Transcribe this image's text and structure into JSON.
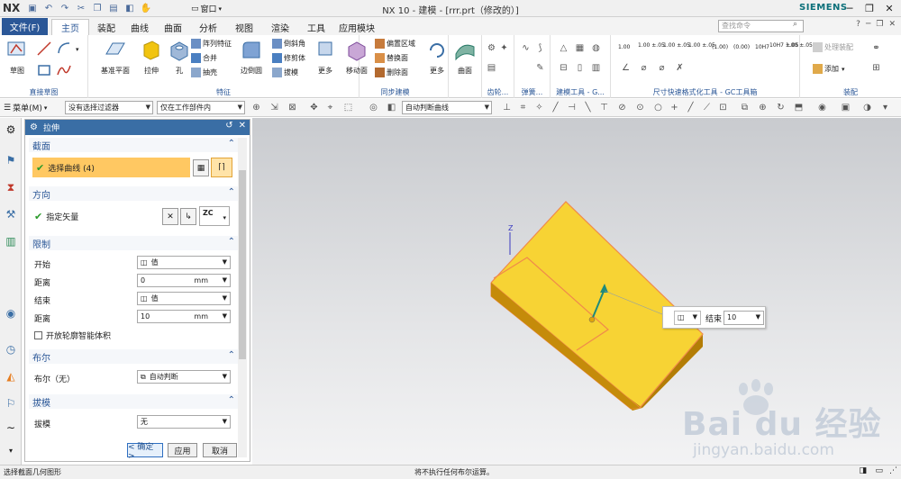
{
  "app": {
    "logo": "NX",
    "title": "NX 10 - 建模 - [rrr.prt（修改的）]",
    "brand": "SIEMENS",
    "window_menu": "窗口"
  },
  "tabs": {
    "file": "文件(F)",
    "items": [
      "主页",
      "装配",
      "曲线",
      "曲面",
      "分析",
      "视图",
      "渲染",
      "工具",
      "应用模块"
    ],
    "active": "主页",
    "search_placeholder": "查找命令"
  },
  "ribbon": {
    "sketch": {
      "big": "草图",
      "group": "直接草图"
    },
    "feature": {
      "datum": "基准平面",
      "extrude": "拉伸",
      "hole": "孔",
      "small": [
        "阵列特征",
        "合并",
        "抽壳"
      ],
      "edge": "边倒圆",
      "small2": [
        "倒斜角",
        "修剪体",
        "拔模"
      ],
      "more": "更多",
      "group": "特征"
    },
    "sync": {
      "move": "移动面",
      "small": [
        "偏置区域",
        "替换面",
        "删除面"
      ],
      "more": "更多",
      "group": "同步建模"
    },
    "surface": {
      "big": "曲面"
    },
    "small_groups": {
      "gear": "齿轮...",
      "spring": "弹簧...",
      "tools": "建模工具 - G..."
    },
    "dim": {
      "group": "尺寸快速格式化工具 - GC工具箱",
      "labels": [
        "1.00",
        "1.00 ±.05",
        "1.00 ±.05",
        "1.00 ±.05",
        "(1.00)",
        "(0.00)",
        "10H7",
        "10H7 ±.05",
        "1.00 ±.05"
      ]
    },
    "assembly": {
      "process": "处理装配",
      "add": "添加",
      "group": "装配"
    }
  },
  "toolbar2": {
    "menu": "菜单(M)",
    "filter": "没有选择过滤器",
    "scope": "仅在工作部件内",
    "curve_rule": "自动判断曲线"
  },
  "dialog": {
    "title": "拉伸",
    "sections": {
      "section": "截面",
      "direction": "方向",
      "limits": "限制",
      "boolean": "布尔",
      "draft": "拔模"
    },
    "select_curve": "选择曲线 (4)",
    "specify_vector": "指定矢量",
    "vector_label": "ZC",
    "start_label": "开始",
    "start_value": "值",
    "distance_label": "距离",
    "start_distance": "0",
    "end_label": "结束",
    "end_value": "值",
    "end_distance": "10",
    "unit": "mm",
    "open_profile": "开放轮廓智能体积",
    "boolean_label": "布尔（无）",
    "boolean_value": "自动判断",
    "draft_label": "拔模",
    "draft_value": "无",
    "ok": "< 确定 >",
    "apply": "应用",
    "cancel": "取消"
  },
  "viewport": {
    "axis_label": "Z",
    "popup_label": "结束",
    "popup_value": "10"
  },
  "watermark": {
    "brand": "Bai du 经验",
    "url": "jingyan.baidu.com"
  },
  "status": {
    "left": "选择截面几何图形",
    "center": "将不执行任何布尔运算。"
  },
  "colors": {
    "accent": "#2b5797",
    "selection": "#ffc862",
    "solid_top": "#f7d334",
    "solid_front": "#c58b0a",
    "solid_edge": "#f08a4b"
  }
}
